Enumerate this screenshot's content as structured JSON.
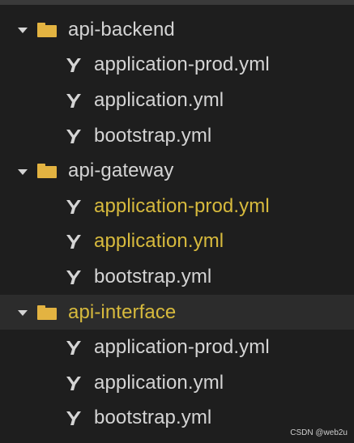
{
  "colors": {
    "background": "#1e1e1e",
    "text": "#d4d4d4",
    "modified_text": "#d7ba3d",
    "folder": "#e3b341",
    "selected_row": "#2c2c2c"
  },
  "tree": {
    "folders": [
      {
        "name": "api-backend",
        "expanded": true,
        "selected": false,
        "modified": false,
        "icon": "folder-icon",
        "files": [
          {
            "name": "application-prod.yml",
            "icon": "yaml-icon",
            "modified": false
          },
          {
            "name": "application.yml",
            "icon": "yaml-icon",
            "modified": false
          },
          {
            "name": "bootstrap.yml",
            "icon": "yaml-icon",
            "modified": false
          }
        ]
      },
      {
        "name": "api-gateway",
        "expanded": true,
        "selected": false,
        "modified": false,
        "icon": "folder-icon",
        "files": [
          {
            "name": "application-prod.yml",
            "icon": "yaml-icon",
            "modified": true
          },
          {
            "name": "application.yml",
            "icon": "yaml-icon",
            "modified": true
          },
          {
            "name": "bootstrap.yml",
            "icon": "yaml-icon",
            "modified": false
          }
        ]
      },
      {
        "name": "api-interface",
        "expanded": true,
        "selected": true,
        "modified": true,
        "icon": "folder-icon",
        "files": [
          {
            "name": "application-prod.yml",
            "icon": "yaml-icon",
            "modified": false
          },
          {
            "name": "application.yml",
            "icon": "yaml-icon",
            "modified": false
          },
          {
            "name": "bootstrap.yml",
            "icon": "yaml-icon",
            "modified": false
          }
        ]
      }
    ]
  },
  "watermark": "CSDN @web2u"
}
